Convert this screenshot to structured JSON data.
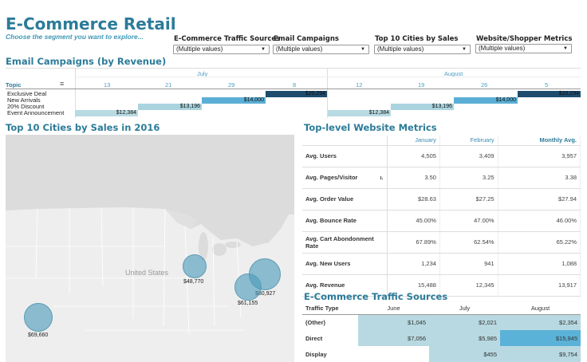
{
  "header": {
    "title": "E-Commerce Retail",
    "subtitle": "Choose the segment you want to explore..."
  },
  "filters": [
    {
      "label": "E-Commerce Traffic Sources",
      "value": "(Multiple values)"
    },
    {
      "label": "Email Campaigns",
      "value": "(Multiple values)"
    },
    {
      "label": "Top 10 Cities by Sales",
      "value": "(Multiple values)"
    },
    {
      "label": "Website/Shopper Metrics",
      "value": "(Multiple values)"
    }
  ],
  "email": {
    "title": "Email Campaigns (by Revenue)",
    "topic_header": "Topic",
    "months": [
      "July",
      "August"
    ],
    "july_days": [
      "13",
      "21",
      "29",
      "8"
    ],
    "aug_days": [
      "12",
      "19",
      "26",
      "5"
    ],
    "topics": [
      "Exclusive Deal",
      "New Arrivals",
      "20% Discount",
      "Event Announcement"
    ],
    "values": [
      "$20,294",
      "$14,000",
      "$13,196",
      "$12,384"
    ],
    "colors": [
      "#1d4c6e",
      "#5bafd6",
      "#a9d4df",
      "#b8dbe3"
    ]
  },
  "map": {
    "title": "Top 10 Cities by Sales in 2016",
    "country_label": "United States",
    "cities": [
      {
        "value": "$48,770"
      },
      {
        "value": "$80,927"
      },
      {
        "value": "$61,155"
      },
      {
        "value": "$69,660"
      }
    ]
  },
  "metrics": {
    "title": "Top-level Website Metrics",
    "columns": [
      "January",
      "February",
      "Monthly Avg."
    ],
    "rows": [
      {
        "label": "Avg. Users",
        "v": [
          "4,505",
          "3,409",
          "3,957"
        ]
      },
      {
        "label": "Avg. Pages/Visitor",
        "v": [
          "3.50",
          "3.25",
          "3.38"
        ]
      },
      {
        "label": "Avg. Order Value",
        "v": [
          "$28.63",
          "$27.25",
          "$27.94"
        ]
      },
      {
        "label": "Avg. Bounce Rate",
        "v": [
          "45.00%",
          "47.00%",
          "46.00%"
        ]
      },
      {
        "label": "Avg. Cart Abondonment Rate",
        "v": [
          "67.89%",
          "62.54%",
          "65.22%"
        ]
      },
      {
        "label": "Avg. New Users",
        "v": [
          "1,234",
          "941",
          "1,088"
        ]
      },
      {
        "label": "Avg. Revenue",
        "v": [
          "15,488",
          "12,345",
          "13,917"
        ]
      }
    ]
  },
  "traffic": {
    "title": "E-Commerce Traffic Sources",
    "header": "Traffic Type",
    "columns": [
      "June",
      "July",
      "August"
    ],
    "rows": [
      {
        "label": "(Other)",
        "v": [
          "$1,045",
          "$2,021",
          "$2,354"
        ]
      },
      {
        "label": "Direct",
        "v": [
          "$7,056",
          "$5,985",
          "$15,945"
        ]
      },
      {
        "label": "Display",
        "v": [
          "",
          "$455",
          "$9,754"
        ]
      }
    ]
  }
}
